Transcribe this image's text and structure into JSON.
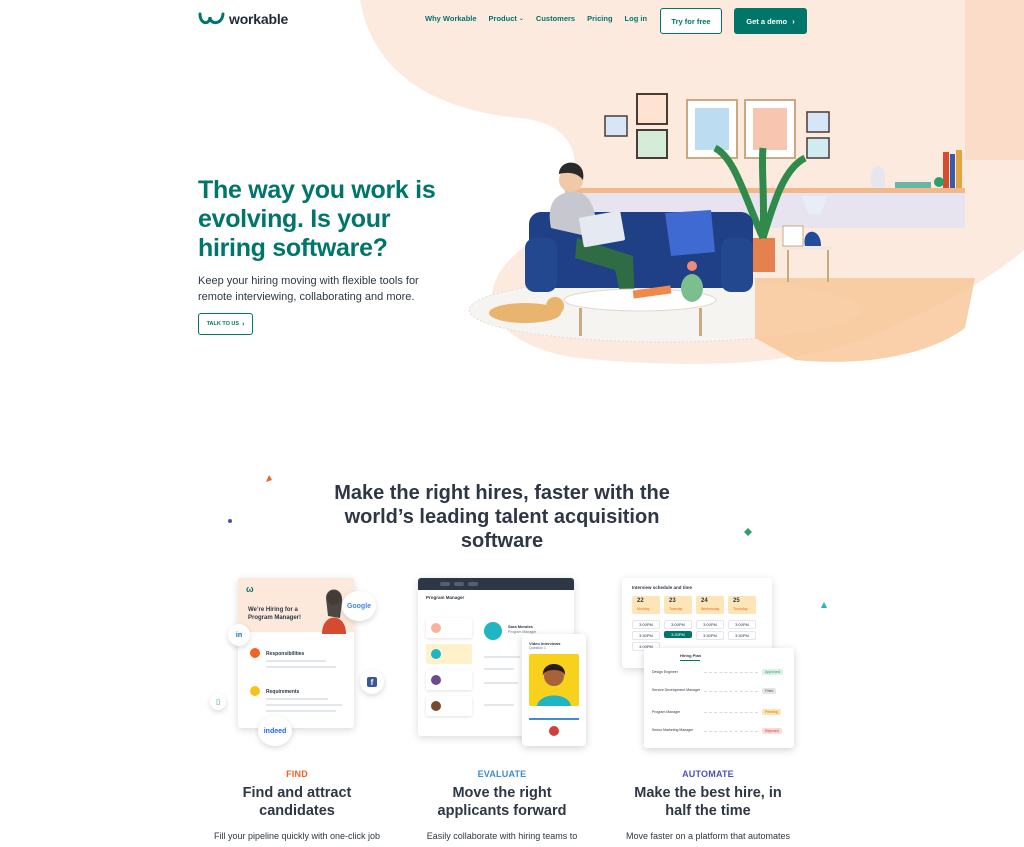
{
  "header": {
    "logo_text": "workable",
    "nav": [
      {
        "label": "Why Workable"
      },
      {
        "label": "Product",
        "has_caret": true
      },
      {
        "label": "Customers"
      },
      {
        "label": "Pricing"
      },
      {
        "label": "Log in"
      }
    ],
    "try_free_label": "Try for free",
    "demo_label": "Get a demo"
  },
  "hero": {
    "title": "The way you work is evolving. Is your hiring software?",
    "subtitle": "Keep your hiring moving with flexible tools for remote interviewing, collaborating and more.",
    "cta_label": "TALK TO US"
  },
  "section": {
    "title": "Make the right hires, faster with the world’s leading talent acquisition software",
    "columns": [
      {
        "label": "FIND",
        "label_color": "#f26322",
        "title": "Find and attract candidates",
        "desc": "Fill your pipeline quickly with one-click job",
        "card": {
          "heading": "We’re Hiring for a Program Manager!",
          "row1": "Responsibilities",
          "row2": "Requirements",
          "google": "Google",
          "indeed": "indeed"
        }
      },
      {
        "label": "EVALUATE",
        "label_color": "#3b8ed0",
        "title": "Move the right applicants forward",
        "desc": "Easily collaborate with hiring teams to",
        "card": {
          "header": "Program Manager",
          "person_name": "Sara Morales",
          "person_role": "Program Manager",
          "video_title": "Video Interviews",
          "video_q": "Question 1"
        }
      },
      {
        "label": "AUTOMATE",
        "label_color": "#4b4fbd",
        "title": "Make the best hire, in half the time",
        "desc": "Move faster on a platform that automates",
        "card": {
          "schedule_title": "Interview schedule and time",
          "days": [
            {
              "num": "22",
              "day": "Monday"
            },
            {
              "num": "23",
              "day": "Tuesday"
            },
            {
              "num": "24",
              "day": "Wednesday"
            },
            {
              "num": "25",
              "day": "Thursday"
            }
          ],
          "times": [
            "3:00PM",
            "3:00PM",
            "3:00PM",
            "3:00PM",
            "3:30PM",
            "3:30PM",
            "3:30PM",
            "3:30PM",
            "4:00PM"
          ],
          "plan_title": "Hiring Plan",
          "roles": [
            {
              "name": "Design Engineer",
              "status": "Approved",
              "color": "#2f9e6b",
              "bg": "#d9f2e5"
            },
            {
              "name": "Service Development Manager",
              "status": "Filled",
              "color": "#555c66",
              "bg": "#e3e5e8"
            },
            {
              "name": "Program Manager",
              "status": "Pending",
              "color": "#c47a00",
              "bg": "#ffe3b0"
            },
            {
              "name": "Senior Marketing Manager",
              "status": "Rejected",
              "color": "#d0413a",
              "bg": "#fbd9d6"
            }
          ]
        }
      }
    ]
  },
  "colors": {
    "brand": "#00756a",
    "peach": "#fde9dc",
    "navy_sofa": "#1f3f86"
  }
}
